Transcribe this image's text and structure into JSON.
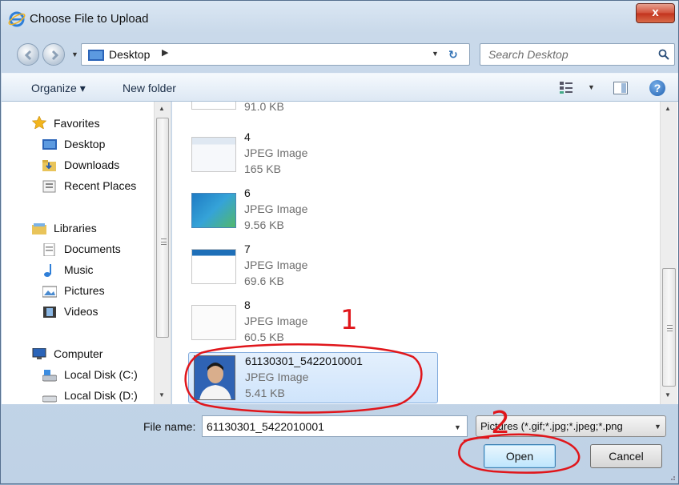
{
  "window": {
    "title": "Choose File to Upload",
    "close_label": "x"
  },
  "address": {
    "location": "Desktop",
    "search_placeholder": "Search Desktop"
  },
  "toolbar": {
    "organize": "Organize ▾",
    "new_folder": "New folder"
  },
  "nav": {
    "favorites": "Favorites",
    "desktop": "Desktop",
    "downloads": "Downloads",
    "recent": "Recent Places",
    "libraries": "Libraries",
    "documents": "Documents",
    "music": "Music",
    "pictures": "Pictures",
    "videos": "Videos",
    "computer": "Computer",
    "disk_c": "Local Disk (C:)",
    "disk_d": "Local Disk (D:)"
  },
  "files": [
    {
      "name": "",
      "type": "",
      "size": "91.0 KB"
    },
    {
      "name": "4",
      "type": "JPEG Image",
      "size": "165 KB"
    },
    {
      "name": "6",
      "type": "JPEG Image",
      "size": "9.56 KB"
    },
    {
      "name": "7",
      "type": "JPEG Image",
      "size": "69.6 KB"
    },
    {
      "name": "8",
      "type": "JPEG Image",
      "size": "60.5 KB"
    },
    {
      "name": "61130301_5422010001",
      "type": "JPEG Image",
      "size": "5.41 KB",
      "selected": true
    }
  ],
  "bottom": {
    "file_name_label": "File name:",
    "file_name_value": "61130301_5422010001",
    "filter": "Pictures (*.gif;*.jpg;*.jpeg;*.png",
    "open": "Open",
    "cancel": "Cancel"
  },
  "annotations": {
    "mark1": "1",
    "mark2": "2",
    "ink_color": "#e0161b"
  },
  "colors": {
    "selection": "#cfe4fb",
    "titlebar": "#c9d9ea",
    "close": "#c2321d"
  }
}
